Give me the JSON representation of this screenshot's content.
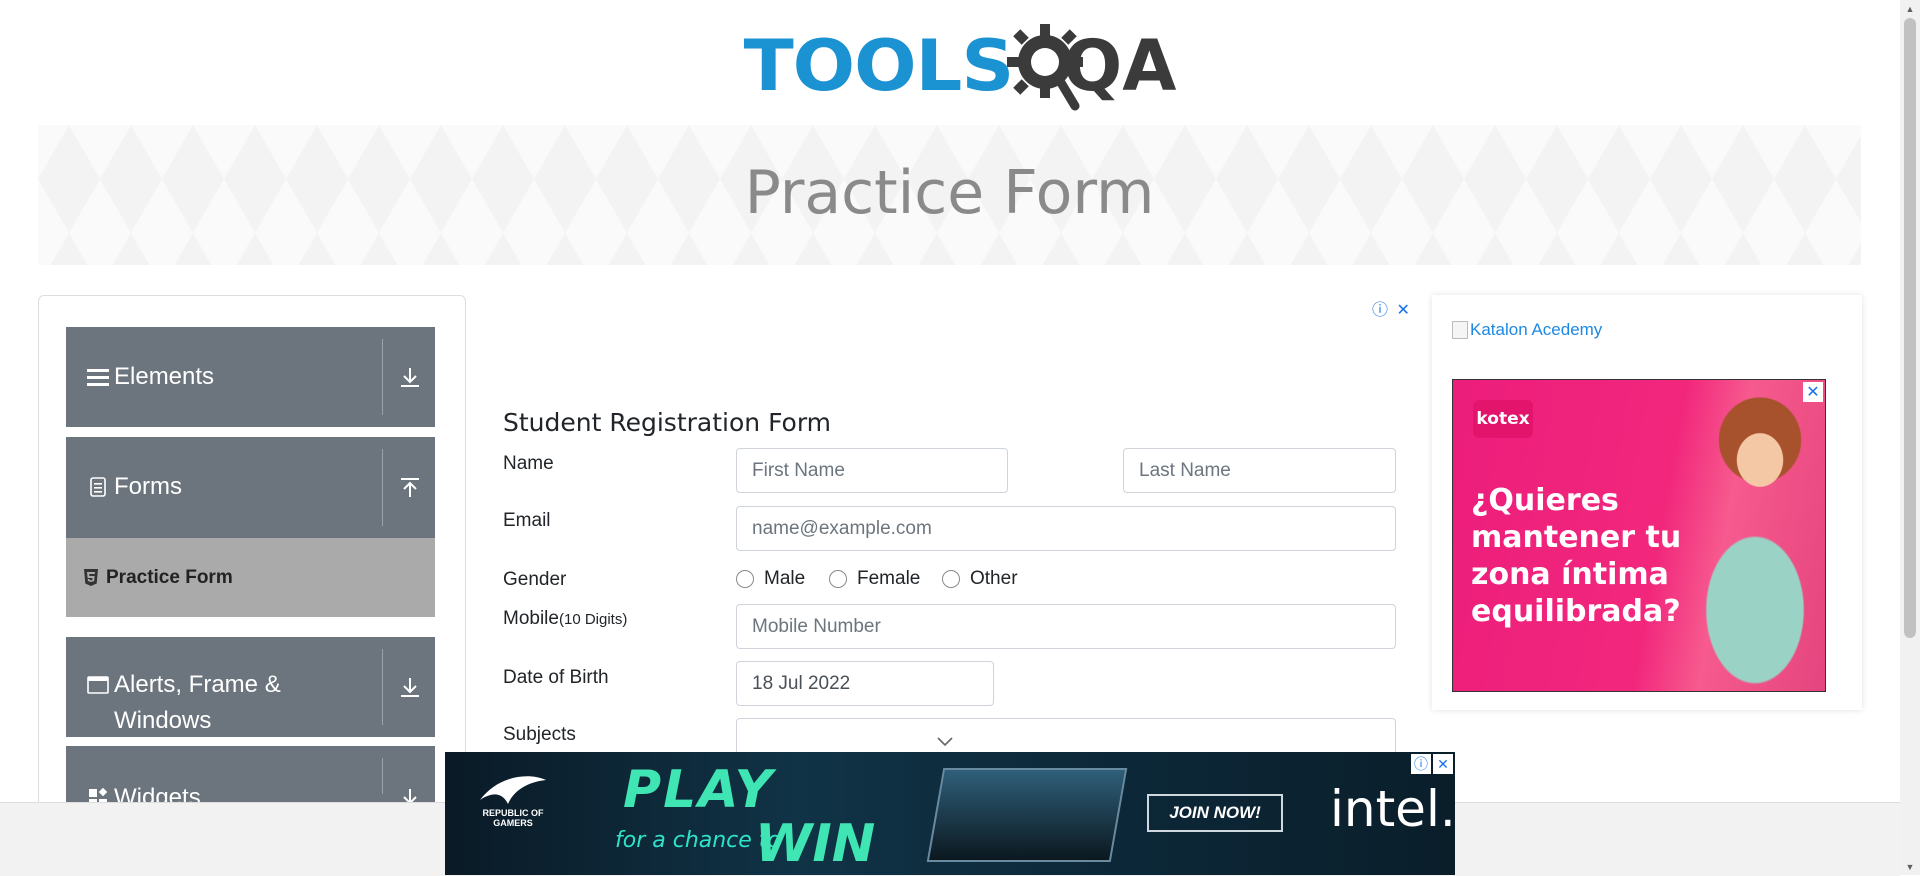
{
  "header": {
    "logo_tools": "TOOLS",
    "logo_qa": "QA"
  },
  "banner": {
    "title": "Practice Form"
  },
  "sidebar": {
    "groups": [
      {
        "label": "Elements",
        "icon": "hamburger-icon",
        "state": "collapsed"
      },
      {
        "label": "Forms",
        "icon": "document-icon",
        "state": "expanded"
      },
      {
        "label": "Alerts, Frame & Windows",
        "label_line1": "Alerts, Frame &",
        "label_line2": "Windows",
        "icon": "window-icon",
        "state": "collapsed"
      },
      {
        "label": "Widgets",
        "icon": "widgets-icon",
        "state": "collapsed"
      }
    ],
    "active_item": {
      "label": "Practice Form",
      "icon": "html5-icon"
    }
  },
  "form": {
    "title": "Student Registration Form",
    "name": {
      "label": "Name",
      "first_placeholder": "First Name",
      "last_placeholder": "Last Name"
    },
    "email": {
      "label": "Email",
      "placeholder": "name@example.com"
    },
    "gender": {
      "label": "Gender",
      "options": [
        "Male",
        "Female",
        "Other"
      ]
    },
    "mobile": {
      "label": "Mobile",
      "hint": "(10 Digits)",
      "placeholder": "Mobile Number"
    },
    "dob": {
      "label": "Date of Birth",
      "value": "18 Jul 2022"
    },
    "subjects": {
      "label": "Subjects"
    }
  },
  "right_ad": {
    "image_alt": "Katalon Acedemy",
    "brand": "kotex",
    "headline": "¿Quieres mantener tu zona íntima equilibrada?"
  },
  "bottom_ad": {
    "rog": "REPUBLIC OF GAMERS",
    "play": "PLAY",
    "chance": "for a chance to",
    "win": "WIN",
    "join": "JOIN NOW!",
    "intel": "intel."
  },
  "colors": {
    "sidebar_group": "#6c757d",
    "active_item": "#aaaaaa",
    "logo_blue": "#1b92d1",
    "ad_pink": "#ec1d7c"
  }
}
